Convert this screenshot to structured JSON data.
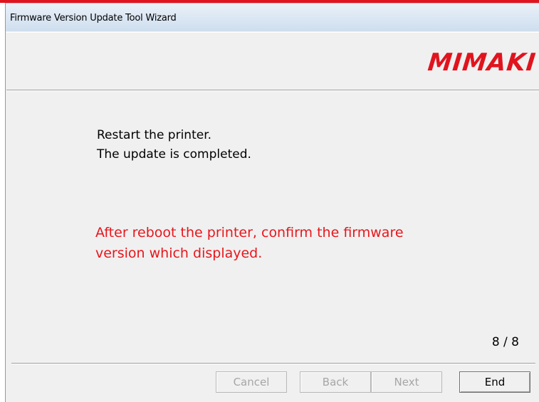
{
  "window": {
    "title": "Firmware Version Update Tool Wizard"
  },
  "header": {
    "logo_text": "Mimaki",
    "logo_color": "#e0141e"
  },
  "content": {
    "message_line1": "Restart the printer.",
    "message_line2": "The update is completed.",
    "warning_line1": "After reboot the printer, confirm the firmware",
    "warning_line2": "version which displayed.",
    "warning_color": "#e8161c",
    "page_indicator": "8 / 8"
  },
  "buttons": {
    "cancel_label": "Cancel",
    "back_label": "Back",
    "next_label": "Next",
    "end_label": "End",
    "cancel_enabled": false,
    "back_enabled": false,
    "next_enabled": false,
    "end_enabled": true
  }
}
